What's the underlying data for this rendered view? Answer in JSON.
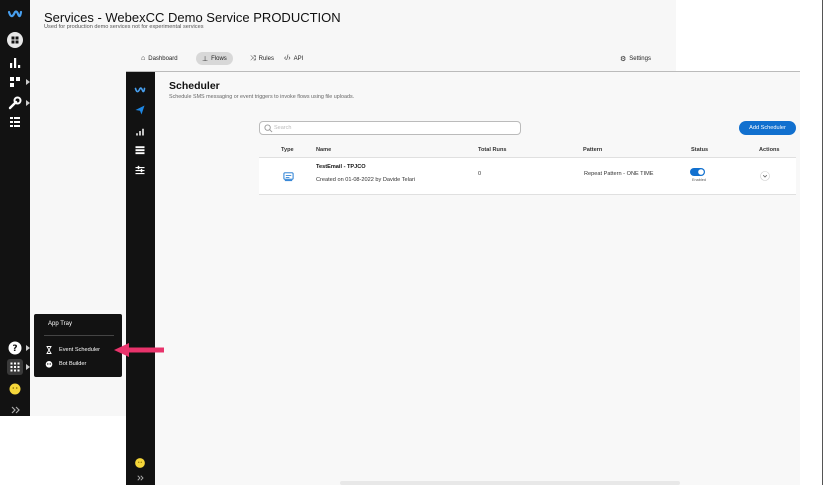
{
  "header": {
    "title": "Services - WebexCC Demo Service PRODUCTION",
    "subtitle": "Used for production demo services not for experimental services"
  },
  "tabs": [
    {
      "label": "Dashboard",
      "icon": "home-icon"
    },
    {
      "label": "Flows",
      "icon": "flows-icon",
      "active": true
    },
    {
      "label": "Rules",
      "icon": "rules-icon"
    },
    {
      "label": "API",
      "icon": "code-icon"
    }
  ],
  "settings_label": "Settings",
  "scheduler": {
    "title": "Scheduler",
    "subtitle": "Schedule SMS messaging or event triggers to invoke flows using file uploads.",
    "add_label": "Add Scheduler",
    "search_placeholder": "Search",
    "columns": [
      "Type",
      "Name",
      "Total Runs",
      "Pattern",
      "Status",
      "Actions"
    ],
    "rows": [
      {
        "type_icon": "sms-icon",
        "name": "TestEmail - TPJCO",
        "created": "Created on 01-08-2022 by Davide Telari",
        "total_runs": "0",
        "pattern": "Repeat Pattern - ONE TIME",
        "status_label": "Enabled",
        "enabled": true
      }
    ]
  },
  "tray": {
    "title": "App Tray",
    "items": [
      {
        "label": "Event Scheduler",
        "icon": "hourglass-icon"
      },
      {
        "label": "Bot Builder",
        "icon": "bot-icon"
      }
    ]
  },
  "colors": {
    "accent": "#1170cf",
    "sidebar": "#121212",
    "arrow": "#e8336b",
    "avatar": "#f5d63a"
  }
}
